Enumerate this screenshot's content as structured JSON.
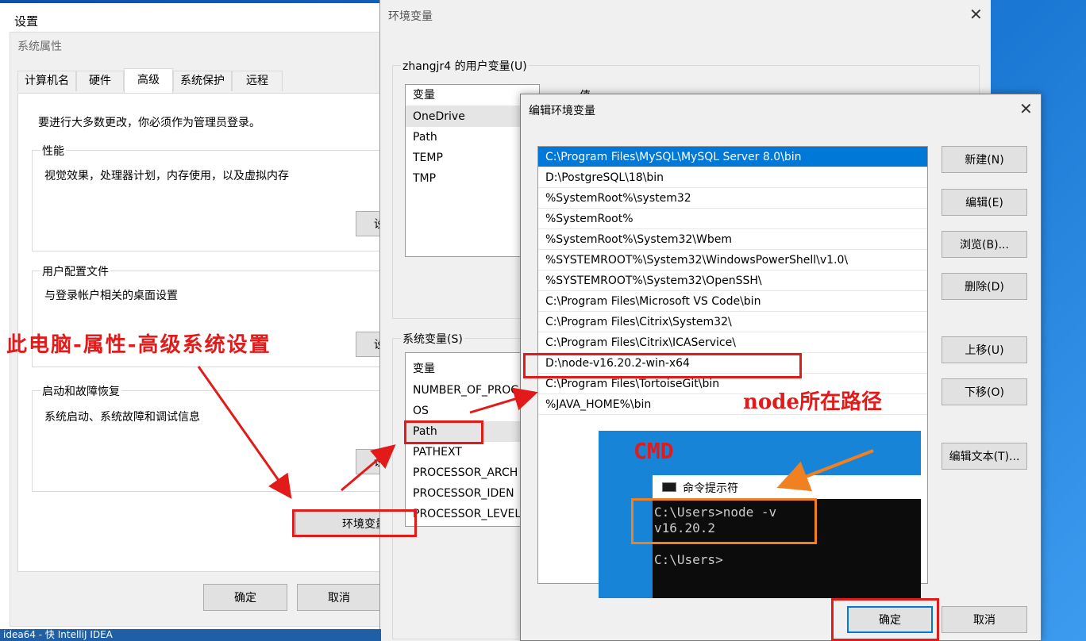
{
  "sysprop": {
    "title": "设置",
    "subtitle": "系统属性",
    "tabs": [
      {
        "label": "计算机名"
      },
      {
        "label": "硬件"
      },
      {
        "label": "高级"
      },
      {
        "label": "系统保护"
      },
      {
        "label": "远程"
      }
    ],
    "admin_note": "要进行大多数更改，你必须作为管理员登录。",
    "perf_title": "性能",
    "perf_desc": "视觉效果，处理器计划，内存使用，以及虚拟内存",
    "perf_btn": "设",
    "profile_title": "用户配置文件",
    "profile_desc": "与登录帐户相关的桌面设置",
    "profile_btn": "设",
    "startup_title": "启动和故障恢复",
    "startup_desc": "系统启动、系统故障和调试信息",
    "startup_btn": "设",
    "env_btn": "环境变量",
    "ok": "确定",
    "cancel": "取消"
  },
  "envvars": {
    "title": "环境变量",
    "user_group": "zhangjr4 的用户变量(U)",
    "col_var": "变量",
    "col_val": "值",
    "user_vars": [
      "OneDrive",
      "Path",
      "TEMP",
      "TMP"
    ],
    "sys_group": "系统变量(S)",
    "sys_vars": [
      "NUMBER_OF_PROC",
      "OS",
      "Path",
      "PATHEXT",
      "PROCESSOR_ARCH",
      "PROCESSOR_IDEN",
      "PROCESSOR_LEVEL"
    ]
  },
  "editenv": {
    "title": "编辑环境变量",
    "paths": [
      "C:\\Program Files\\MySQL\\MySQL Server 8.0\\bin",
      "D:\\PostgreSQL\\18\\bin",
      "%SystemRoot%\\system32",
      "%SystemRoot%",
      "%SystemRoot%\\System32\\Wbem",
      "%SYSTEMROOT%\\System32\\WindowsPowerShell\\v1.0\\",
      "%SYSTEMROOT%\\System32\\OpenSSH\\",
      "C:\\Program Files\\Microsoft VS Code\\bin",
      "C:\\Program Files\\Citrix\\System32\\",
      "C:\\Program Files\\Citrix\\ICAService\\",
      "D:\\node-v16.20.2-win-x64",
      "C:\\Program Files\\TortoiseGit\\bin",
      "%JAVA_HOME%\\bin"
    ],
    "buttons": {
      "new": "新建(N)",
      "edit": "编辑(E)",
      "browse": "浏览(B)...",
      "delete": "删除(D)",
      "up": "上移(U)",
      "down": "下移(O)",
      "edit_text": "编辑文本(T)..."
    },
    "ok": "确定",
    "cancel": "取消"
  },
  "cmd": {
    "label": "CMD",
    "title": "命令提示符",
    "lines": [
      "C:\\Users>node -v",
      "v16.20.2",
      "",
      "C:\\Users>"
    ]
  },
  "annotations": {
    "left": "此电脑-属性-高级系统设置",
    "node": "node所在路径"
  },
  "taskbar": {
    "text": "idea64 - 快  IntelliJ IDEA"
  },
  "colors": {
    "annotation_red": "#e31a1a",
    "cmd_orange": "#f08020",
    "selection_blue": "#0078d7"
  }
}
